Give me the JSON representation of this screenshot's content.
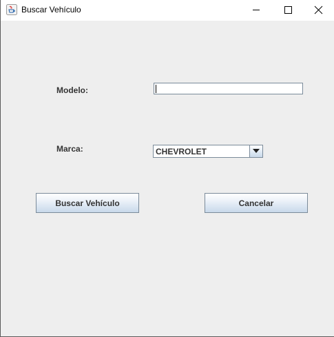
{
  "window": {
    "title": "Buscar Vehículo"
  },
  "form": {
    "modelo_label": "Modelo:",
    "modelo_value": "",
    "marca_label": "Marca:",
    "marca_selected": "CHEVROLET"
  },
  "buttons": {
    "buscar_label": "Buscar Vehículo",
    "cancelar_label": "Cancelar"
  },
  "icons": {
    "app": "java-cup-icon",
    "minimize": "minimize-icon",
    "maximize": "maximize-icon",
    "close": "close-icon",
    "dropdown": "chevron-down-icon"
  }
}
